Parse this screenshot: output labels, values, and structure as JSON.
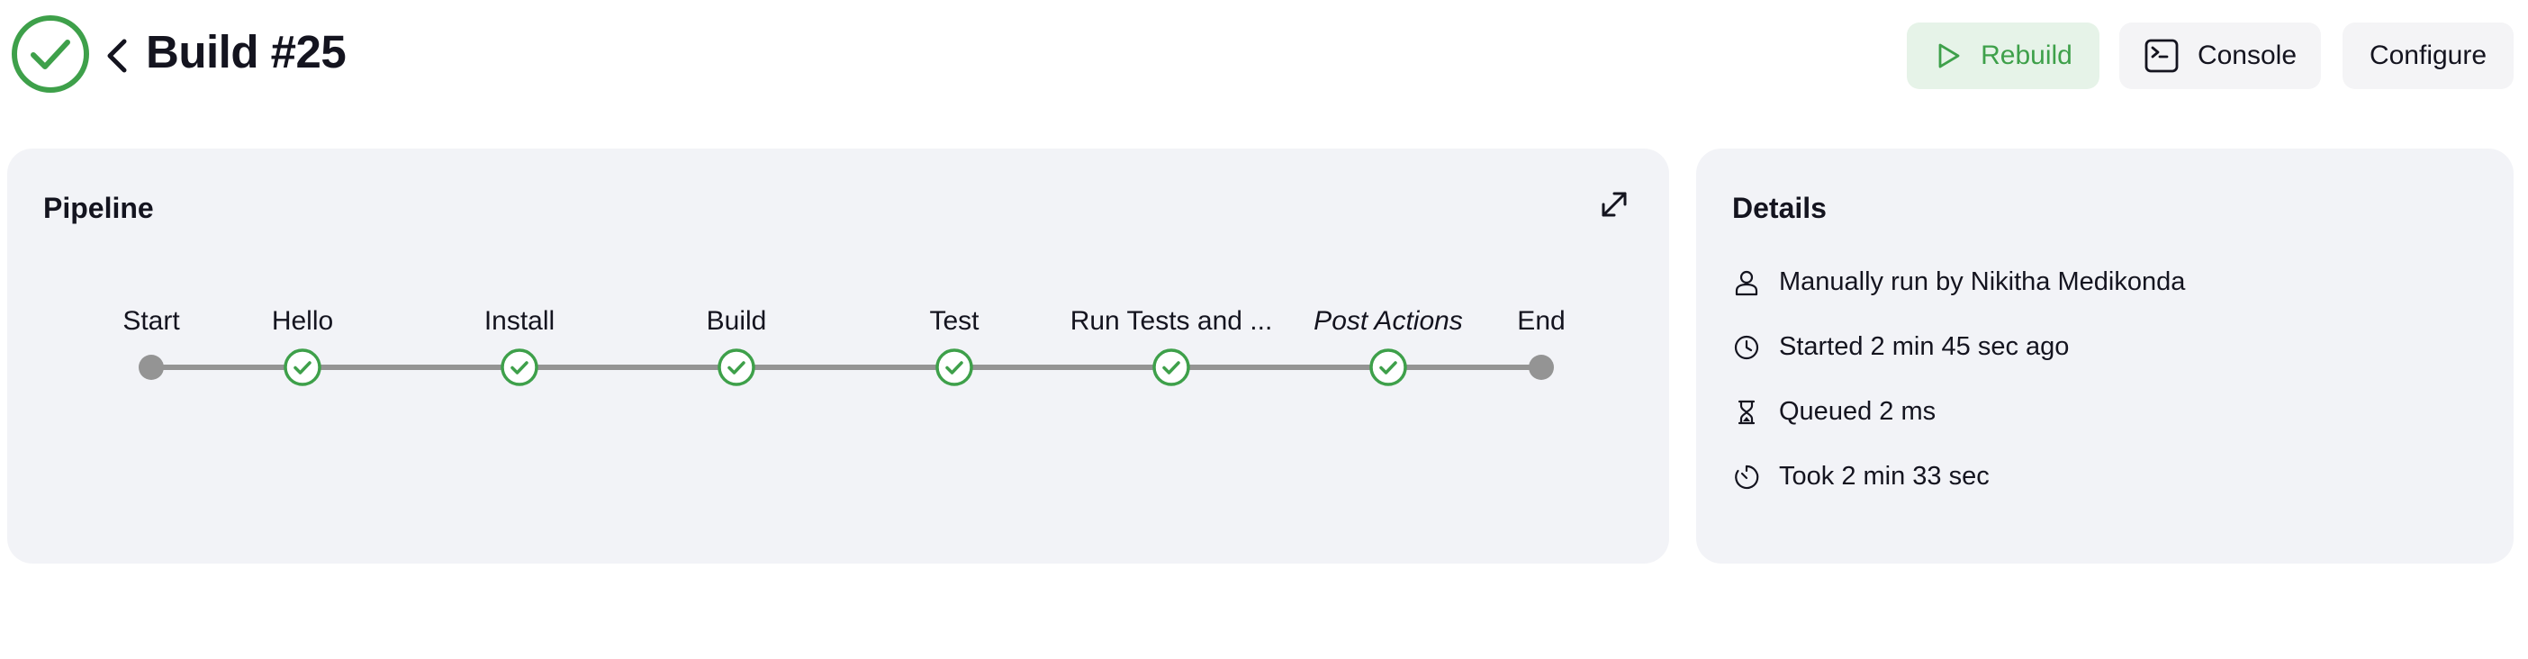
{
  "header": {
    "title": "Build #25",
    "status": "success",
    "status_color": "#3ea04a",
    "buttons": {
      "rebuild": "Rebuild",
      "console": "Console",
      "configure": "Configure"
    }
  },
  "pipeline": {
    "title": "Pipeline",
    "stages": [
      {
        "label": "Start",
        "status": "terminal"
      },
      {
        "label": "Hello",
        "status": "success"
      },
      {
        "label": "Install",
        "status": "success"
      },
      {
        "label": "Build",
        "status": "success"
      },
      {
        "label": "Test",
        "status": "success"
      },
      {
        "label": "Run Tests and ...",
        "status": "success"
      },
      {
        "label": "Post Actions",
        "status": "success"
      },
      {
        "label": "End",
        "status": "terminal"
      }
    ]
  },
  "details": {
    "title": "Details",
    "rows": [
      {
        "icon": "person-icon",
        "text": "Manually run by Nikitha Medikonda"
      },
      {
        "icon": "clock-icon",
        "text": "Started 2 min 45 sec ago"
      },
      {
        "icon": "hourglass-icon",
        "text": "Queued 2 ms"
      },
      {
        "icon": "timer-icon",
        "text": "Took 2 min 33 sec"
      }
    ]
  },
  "colors": {
    "success": "#3ea04a",
    "rebuild_bg": "#e6f3e8",
    "card_bg": "#f2f3f7",
    "button_bg": "#f4f4f6",
    "line_gray": "#949494"
  }
}
